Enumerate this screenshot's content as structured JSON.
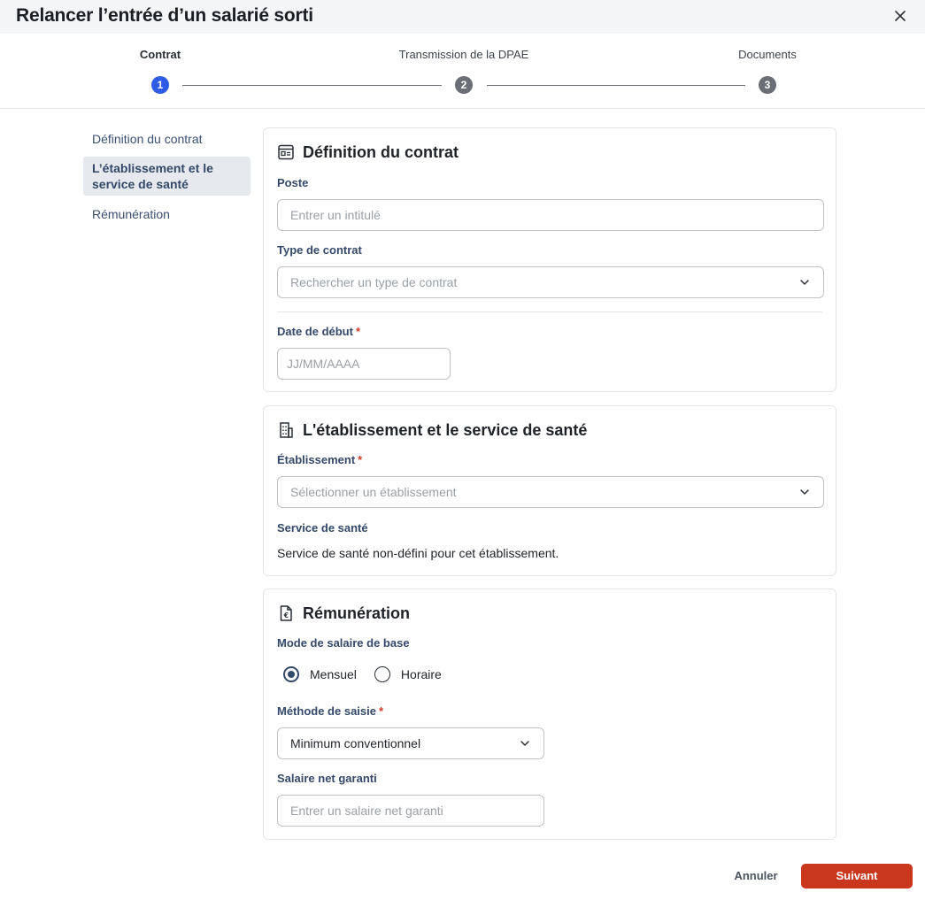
{
  "modal": {
    "title": "Relancer l’entrée d’un salarié sorti"
  },
  "stepper": {
    "steps": [
      {
        "label": "Contrat",
        "number": "1",
        "state": "active"
      },
      {
        "label": "Transmission de la DPAE",
        "number": "2",
        "state": "todo"
      },
      {
        "label": "Documents",
        "number": "3",
        "state": "todo"
      }
    ]
  },
  "sidenav": {
    "items": [
      {
        "label": "Définition du contrat"
      },
      {
        "label": "L’établissement et le service de santé"
      },
      {
        "label": "Rémunération"
      }
    ]
  },
  "contract_section": {
    "title": "Définition du contrat",
    "icon": "contract-icon",
    "poste": {
      "label": "Poste",
      "placeholder": "Entrer un intitulé"
    },
    "type": {
      "label": "Type de contrat",
      "placeholder": "Rechercher un type de contrat"
    },
    "start_date": {
      "label": "Date de début",
      "required": "*",
      "placeholder": "JJ/MM/AAAA"
    }
  },
  "establishment_section": {
    "title": "L'établissement et le service de santé",
    "icon": "building-icon",
    "establishment": {
      "label": "Établissement",
      "required": "*",
      "placeholder": "Sélectionner un établissement"
    },
    "health_service": {
      "label": "Service de santé",
      "value": "Service de santé non-défini pour cet établissement."
    }
  },
  "remuneration_section": {
    "title": "Rémunération",
    "icon": "euro-document-icon",
    "salary_mode": {
      "label": "Mode de salaire de base",
      "options": [
        "Mensuel",
        "Horaire"
      ],
      "selected": "Mensuel"
    },
    "input_method": {
      "label": "Méthode de saisie",
      "required": "*",
      "value": "Minimum conventionnel"
    },
    "net_salary": {
      "label": "Salaire net garanti",
      "placeholder": "Entrer un salaire net garanti"
    }
  },
  "footer": {
    "cancel_label": "Annuler",
    "next_label": "Suivant"
  },
  "colors": {
    "primary_button": "#c9381d",
    "active_step": "#2f5ce6",
    "label_text": "#34496a"
  }
}
